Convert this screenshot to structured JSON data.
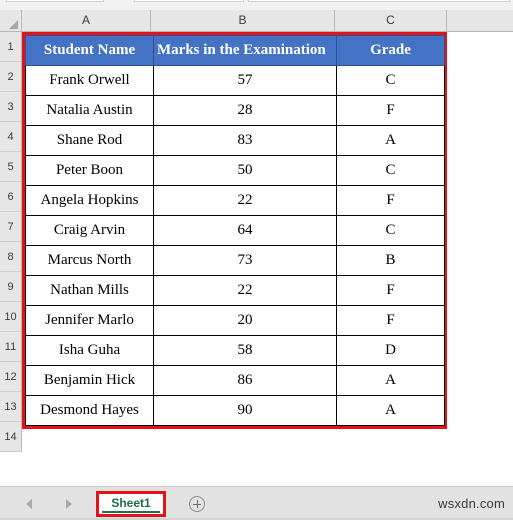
{
  "app": {
    "name": "spreadsheet",
    "watermark": "wsxdn.com"
  },
  "colors": {
    "header_fill": "#4472C4",
    "header_text": "#FFFFFF",
    "selection_outline": "#E8111A",
    "sheet_tab_text": "#1D6B4A",
    "sheet_tab_underline": "#217346",
    "grid_line": "#000000",
    "header_strip": "#E6E6E6"
  },
  "grid": {
    "column_headers": [
      "A",
      "B",
      "C",
      ""
    ],
    "row_headers": [
      "1",
      "2",
      "3",
      "4",
      "5",
      "6",
      "7",
      "8",
      "9",
      "10",
      "11",
      "12",
      "13",
      "14"
    ],
    "select_all_icon": "select-all-triangle-icon"
  },
  "table": {
    "headers": [
      "Student Name",
      "Marks in the Examination",
      "Grade"
    ],
    "rows": [
      [
        "Frank Orwell",
        "57",
        "C"
      ],
      [
        "Natalia Austin",
        "28",
        "F"
      ],
      [
        "Shane Rod",
        "83",
        "A"
      ],
      [
        "Peter Boon",
        "50",
        "C"
      ],
      [
        "Angela Hopkins",
        "22",
        "F"
      ],
      [
        "Craig Arvin",
        "64",
        "C"
      ],
      [
        "Marcus North",
        "73",
        "B"
      ],
      [
        "Nathan Mills",
        "22",
        "F"
      ],
      [
        "Jennifer Marlo",
        "20",
        "F"
      ],
      [
        "Isha Guha",
        "58",
        "D"
      ],
      [
        "Benjamin Hick",
        "86",
        "A"
      ],
      [
        "Desmond Hayes",
        "90",
        "A"
      ]
    ]
  },
  "status_bar": {
    "prev_sheet_icon": "arrow-left-icon",
    "next_sheet_icon": "arrow-right-icon",
    "sheet_tabs": [
      {
        "label": "Sheet1",
        "active": true
      }
    ],
    "add_sheet_icon": "plus-circle-icon"
  }
}
